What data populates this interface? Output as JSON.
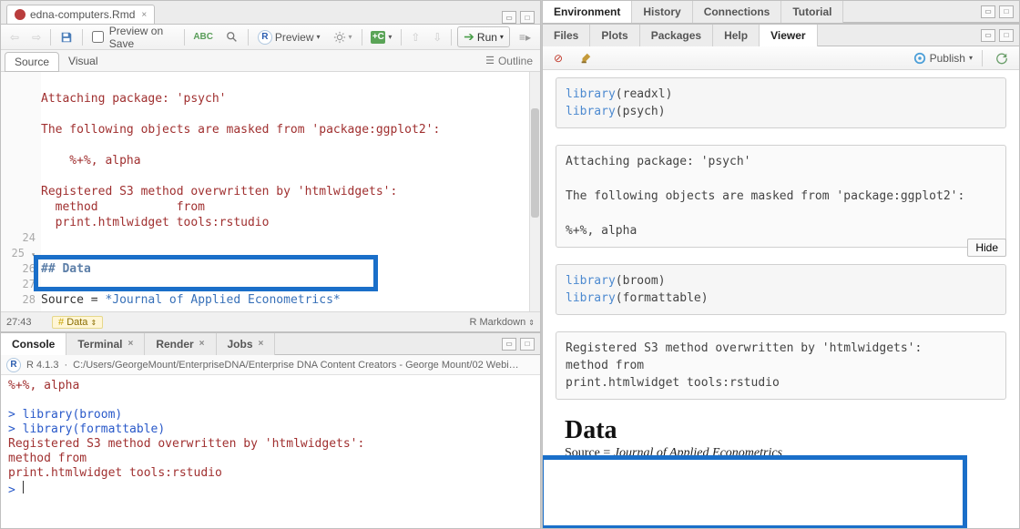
{
  "editor": {
    "filename": "edna-computers.Rmd",
    "view_tabs": {
      "source": "Source",
      "visual": "Visual"
    },
    "toolbar": {
      "preview_on_save": "Preview on Save",
      "preview": "Preview",
      "run": "Run"
    },
    "outline": "Outline",
    "lines": {
      "l24": "24",
      "l25": "25",
      "l26": "26",
      "l27": "27",
      "l28": "28"
    },
    "output_block": {
      "attach": "Attaching package: 'psych'",
      "masked": "The following objects are masked from 'package:ggplot2':",
      "symbols": "    %+%, alpha",
      "s3": "Registered S3 method overwritten by 'htmlwidgets':",
      "method_hdr": "  method           from",
      "method_row": "  print.htmlwidget tools:rstudio"
    },
    "src": {
      "header": "## Data",
      "line27_a": "Source = ",
      "line27_b": "*Journal of Applied Econometrics*"
    },
    "status": {
      "pos": "27:43",
      "crumb": "Data",
      "type": "R Markdown"
    }
  },
  "console": {
    "tabs": {
      "console": "Console",
      "terminal": "Terminal",
      "render": "Render",
      "jobs": "Jobs"
    },
    "rver": "R 4.1.3",
    "path": "C:/Users/GeorgeMount/EnterpriseDNA/Enterprise DNA Content Creators - George Mount/02 Webi…",
    "lines": {
      "sym": "    %+%, alpha",
      "p1": "> ",
      "lib1": "library(broom)",
      "lib2": "library(formattable)",
      "s3": "Registered S3 method overwritten by 'htmlwidgets':",
      "method_hdr": "  method           from",
      "method_row": "  print.htmlwidget tools:rstudio",
      "prompt": "> "
    }
  },
  "right": {
    "top_tabs": {
      "environment": "Environment",
      "history": "History",
      "connections": "Connections",
      "tutorial": "Tutorial"
    },
    "bottom_tabs": {
      "files": "Files",
      "plots": "Plots",
      "packages": "Packages",
      "help": "Help",
      "viewer": "Viewer"
    },
    "publish": "Publish",
    "hide": "Hide",
    "code1": {
      "lib_a": "library",
      "arg_a": "(readxl)",
      "lib_b": "library",
      "arg_b": "(psych)"
    },
    "out2": {
      "attach": "Attaching package: 'psych'",
      "masked": "The following objects are masked from 'package:ggplot2':",
      "sym": "    %+%, alpha"
    },
    "code3": {
      "lib_a": "library",
      "arg_a": "(broom)",
      "lib_b": "library",
      "arg_b": "(formattable)"
    },
    "out4": {
      "s3": "Registered S3 method overwritten by 'htmlwidgets':",
      "hdr": "  method           from",
      "row": "  print.htmlwidget tools:rstudio"
    },
    "rendered": {
      "heading": "Data",
      "text_a": "Source = ",
      "text_b": "Journal of Applied Econometrics"
    }
  }
}
